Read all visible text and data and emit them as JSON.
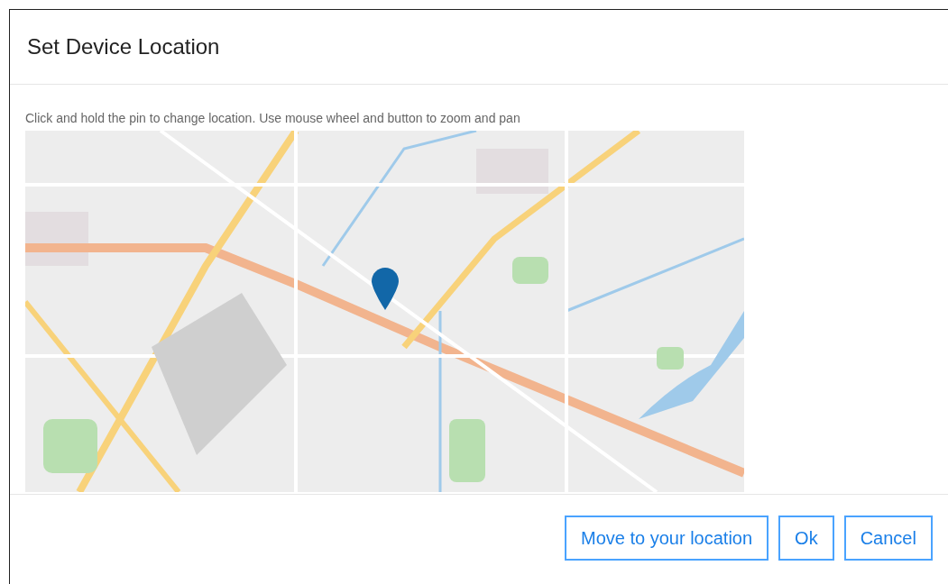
{
  "dialog": {
    "title": "Set Device Location",
    "instruction": "Click and hold the pin to change location. Use mouse wheel and button to zoom and pan",
    "buttons": [
      {
        "label": "Move to your location"
      },
      {
        "label": "Ok"
      },
      {
        "label": "Cancel"
      }
    ]
  }
}
